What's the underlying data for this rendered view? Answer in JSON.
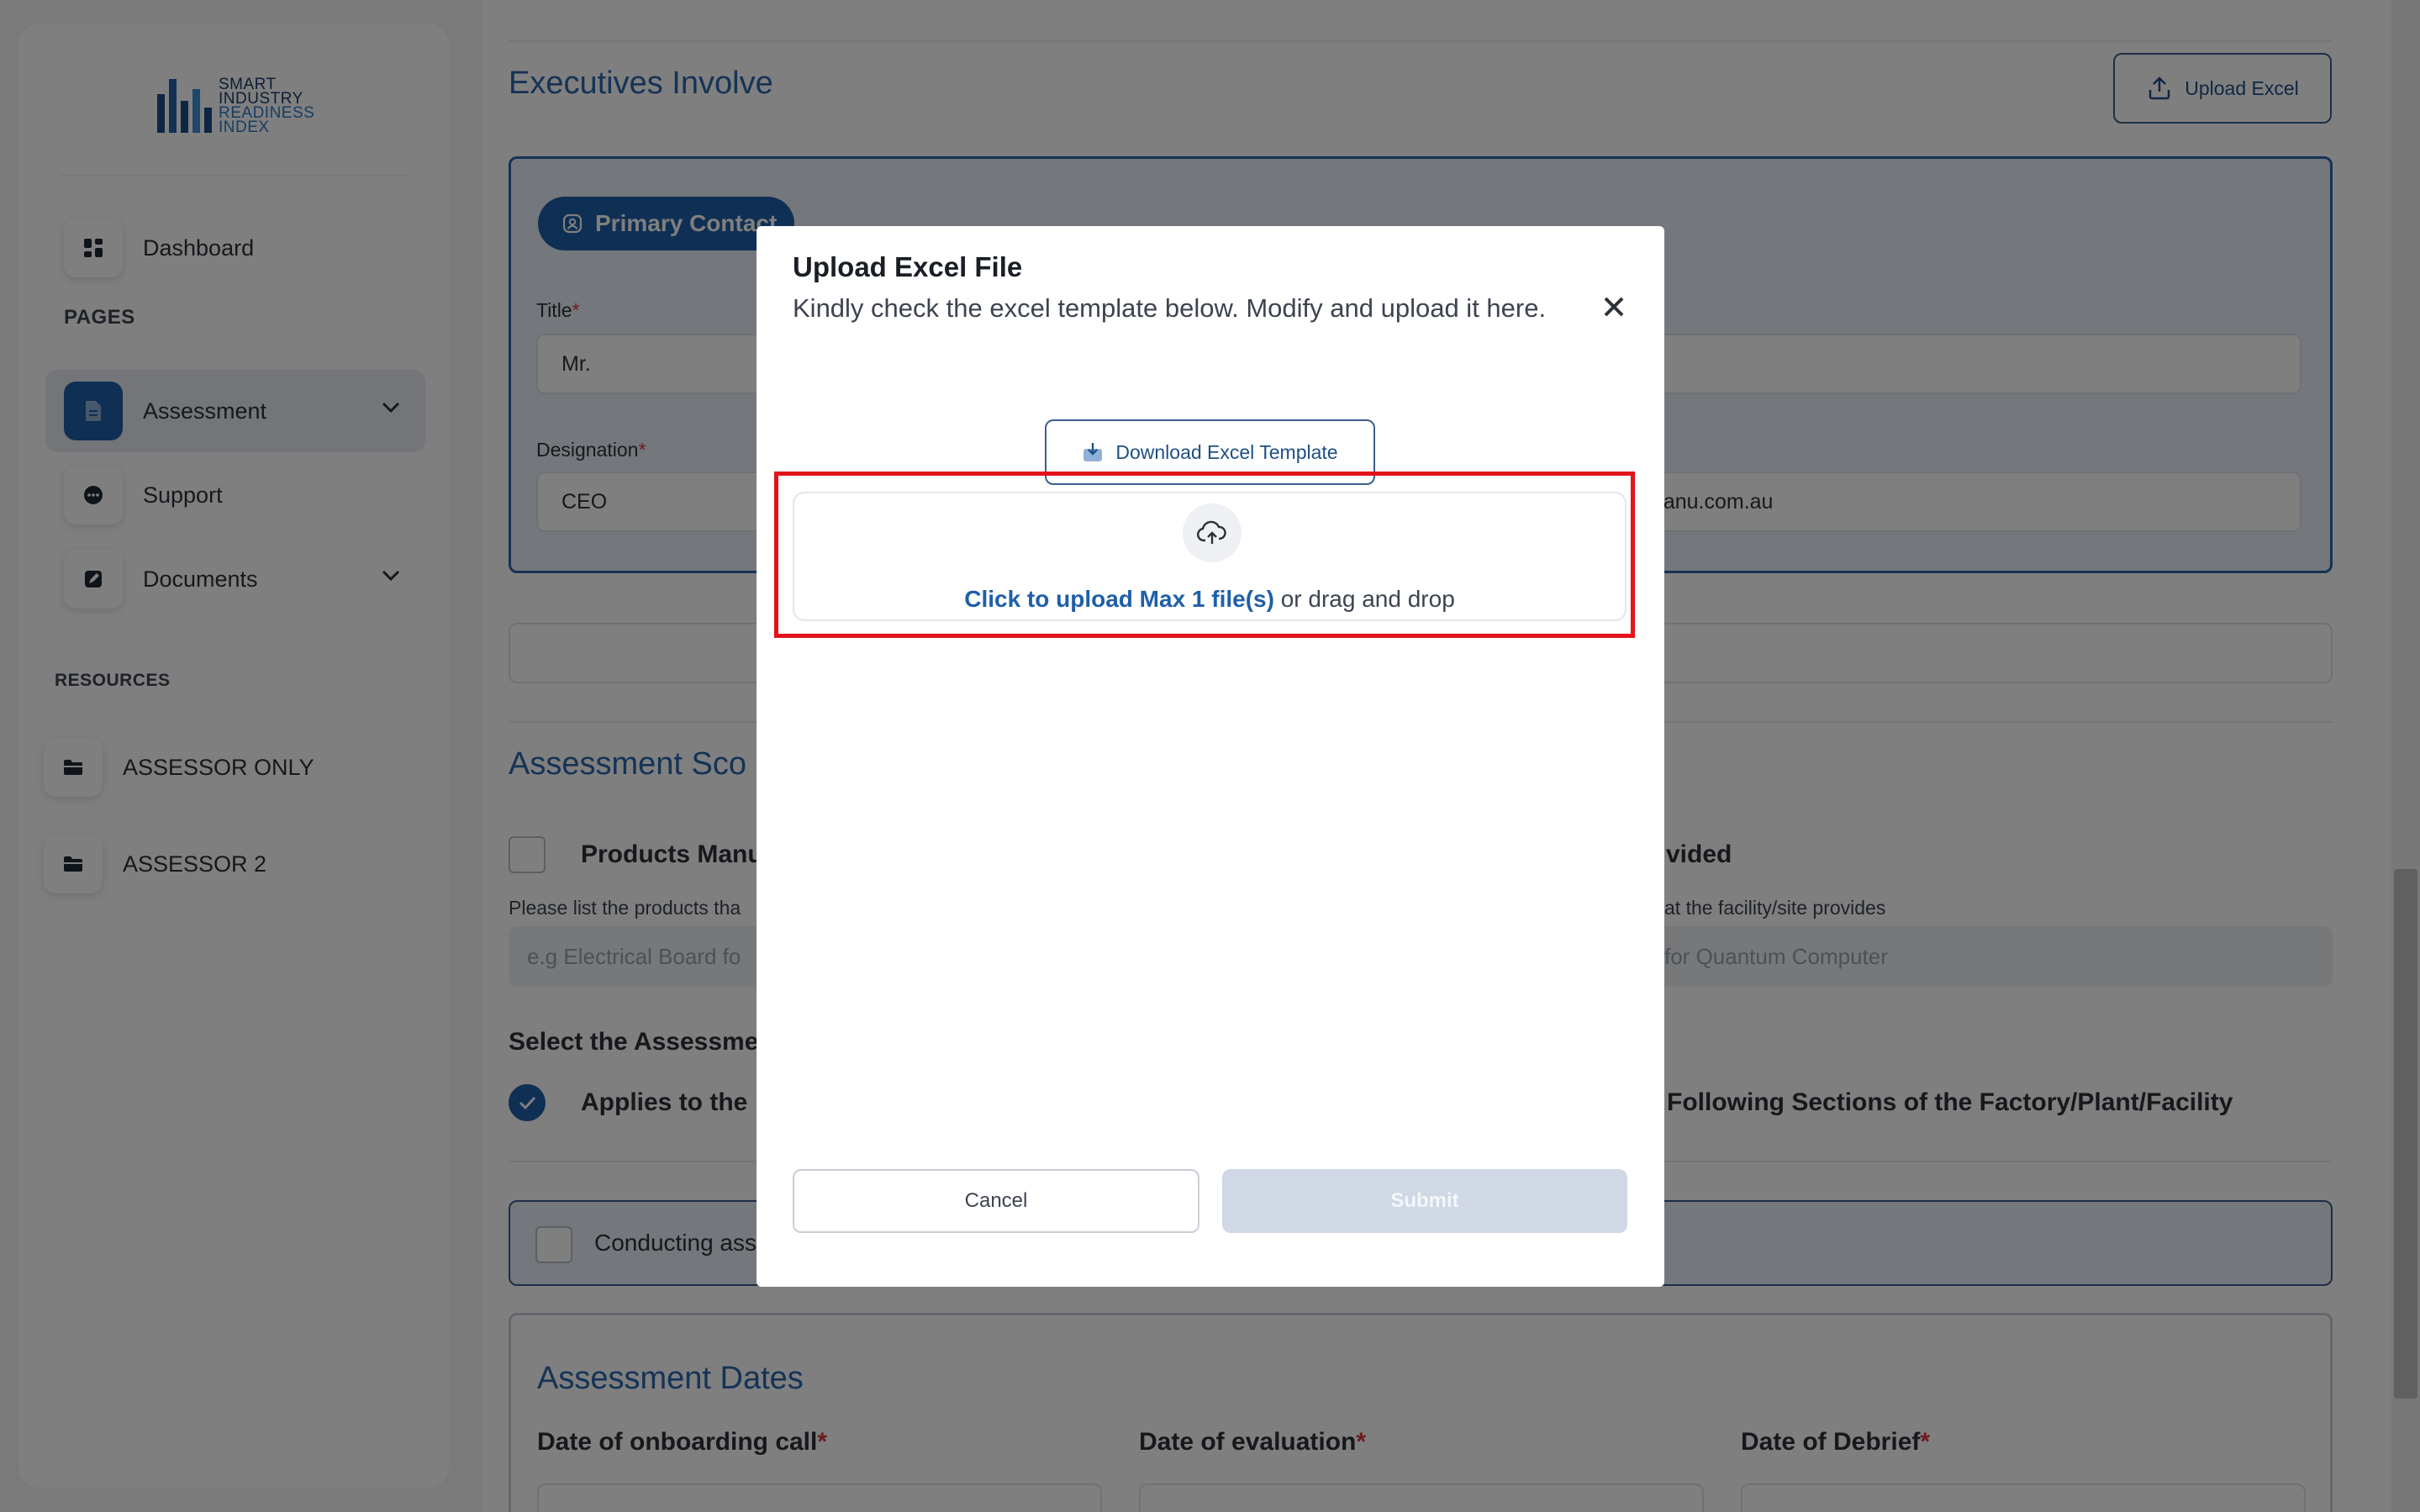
{
  "sidebar": {
    "logo": {
      "line1": "SMART",
      "line2": "INDUSTRY",
      "line3": "READINESS",
      "line4": "INDEX"
    },
    "dashboard_label": "Dashboard",
    "pages_section": "PAGES",
    "assessment_label": "Assessment",
    "support_label": "Support",
    "documents_label": "Documents",
    "resources_section": "RESOURCES",
    "resources": [
      "ASSESSOR ONLY",
      "ASSESSOR 2"
    ]
  },
  "main": {
    "executives_title": "Executives Involve",
    "upload_excel_label": "Upload Excel",
    "primary_contact_label": "Primary Contact",
    "title_field": {
      "label": "Title",
      "value": "Mr."
    },
    "designation_field": {
      "label": "Designation",
      "value": "CEO"
    },
    "email_partial": "manu.com.au",
    "assessment_scope_title": "Assessment Sco",
    "products_label": "Products Manu",
    "services_label": "vided",
    "products_help": "Please list the products tha",
    "services_help": "at the facility/site provides",
    "products_placeholder": "e.g Electrical Board fo",
    "services_placeholder": "for Quantum Computer",
    "select_assessment_label": "Select the Assessme",
    "applies_label": "Applies to the",
    "sections_label": "e Following Sections of the Factory/Plant/Facility",
    "conducting_label": "Conducting ass",
    "assessment_dates_title": "Assessment Dates",
    "date_onboarding_label": "Date of onboarding call",
    "date_evaluation_label": "Date of evaluation",
    "date_debrief_label": "Date of Debrief",
    "required_mark": "*"
  },
  "modal": {
    "title": "Upload Excel File",
    "subtitle": "Kindly check the excel template below. Modify and upload it here.",
    "download_label": "Download Excel Template",
    "upload_link": "Click to upload Max 1 file(s)",
    "upload_rest": " or drag and drop",
    "cancel_label": "Cancel",
    "submit_label": "Submit"
  },
  "colors": {
    "accent": "#1f5fa8",
    "highlight": "#e3131b",
    "required": "#d9363e"
  },
  "icons": {
    "dashboard": "grid-icon",
    "assessment": "document-icon",
    "support": "chat-icon",
    "documents": "edit-icon",
    "resource": "folder-icon",
    "upload_excel": "upload-icon",
    "primary_contact": "contact-icon",
    "close": "close-icon",
    "download": "download-icon",
    "dropzone": "cloud-upload-icon",
    "checkbox": "check-icon"
  }
}
